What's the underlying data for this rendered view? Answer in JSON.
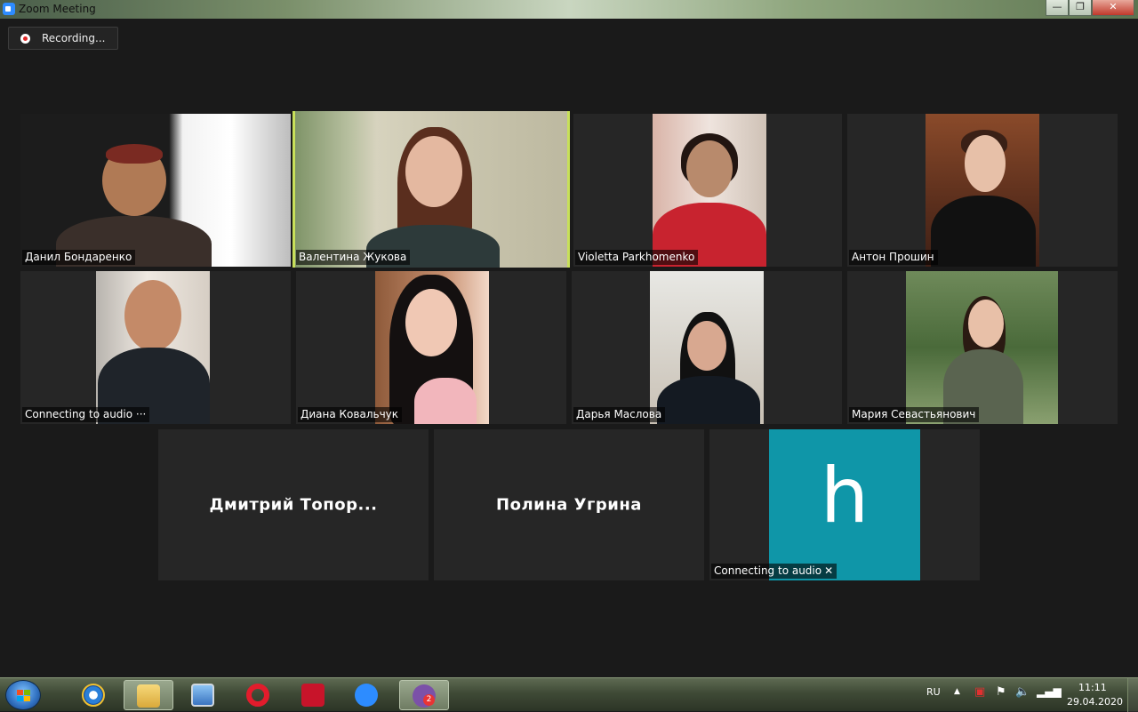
{
  "window": {
    "title": "Zoom Meeting",
    "min_label": "—",
    "max_label": "❐",
    "close_label": "✕"
  },
  "recording": {
    "label": "Recording..."
  },
  "participants": [
    {
      "name": "Данил Бондаренко",
      "active": false
    },
    {
      "name": "Валентина Жукова",
      "active": true
    },
    {
      "name": "Violetta Parkhomenko",
      "active": false
    },
    {
      "name": "Антон Прошин",
      "active": false
    },
    {
      "name": "Connecting to audio ···",
      "active": false
    },
    {
      "name": "Диана Ковальчук",
      "active": false
    },
    {
      "name": "Дарья Маслова",
      "active": false
    },
    {
      "name": "Мария Севастьянович",
      "active": false
    },
    {
      "name": "Дмитрий  Топор...",
      "active": false
    },
    {
      "name": "Полина Угрина",
      "active": false
    },
    {
      "name": "Connecting to audio",
      "avatar_letter": "h",
      "active": false
    }
  ],
  "colors": {
    "active_border": "#c8e05a",
    "avatar_bg": "#0f96a8"
  },
  "taskbar": {
    "apps": [
      "start-button",
      "internet-explorer-icon",
      "file-explorer-icon",
      "network-icon",
      "opera-icon",
      "adobe-reader-icon",
      "zoom-icon",
      "viber-icon"
    ],
    "viber_badge": "2",
    "language": "RU",
    "time": "11:11",
    "date": "29.04.2020"
  }
}
